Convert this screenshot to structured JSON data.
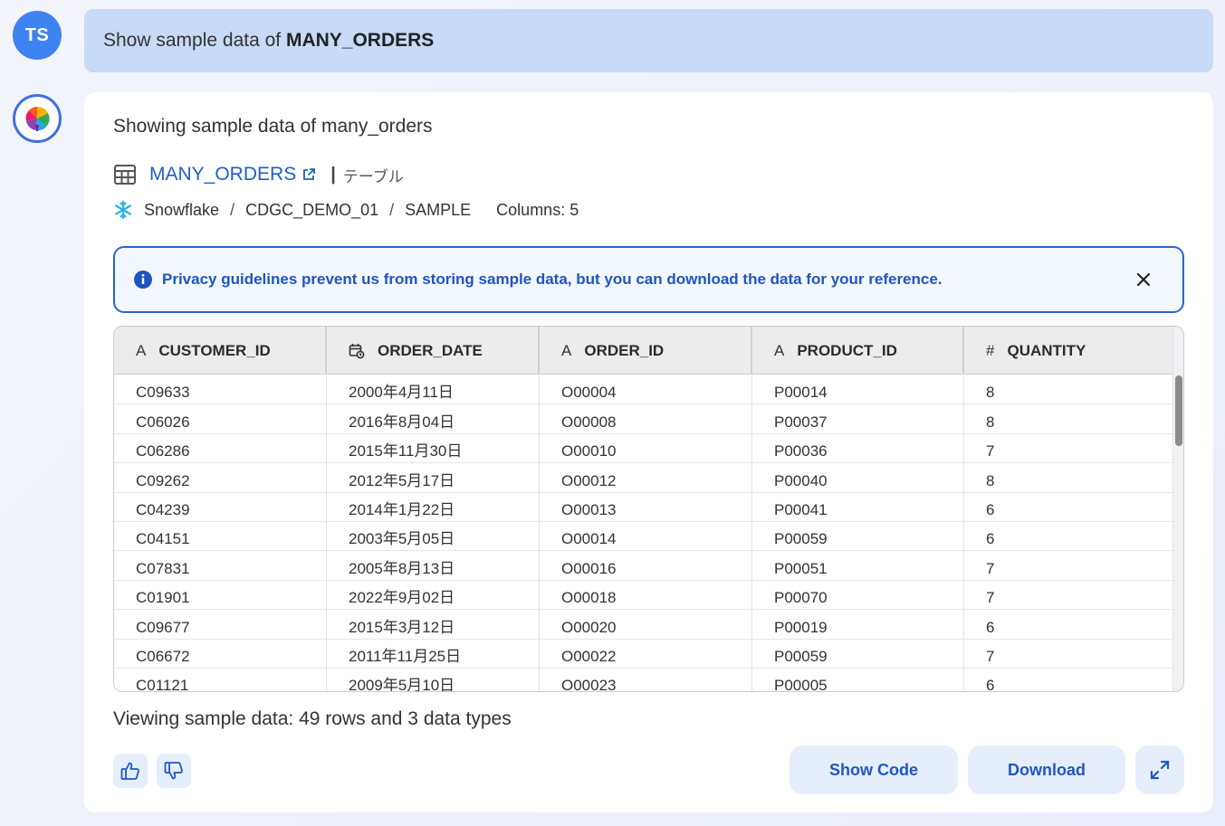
{
  "user": {
    "initials": "TS",
    "message_prefix": "Show sample data of ",
    "message_bold": "MANY_ORDERS"
  },
  "response": {
    "intro": "Showing sample data of many_orders",
    "asset_name": "MANY_ORDERS",
    "asset_separator": "|",
    "asset_type": "テーブル",
    "path": {
      "system": "Snowflake",
      "database": "CDGC_DEMO_01",
      "schema": "SAMPLE",
      "separator": "/",
      "columns_label": "Columns: 5"
    },
    "banner": "Privacy guidelines prevent us from storing sample data, but you can download the data for your reference.",
    "summary": "Viewing sample data: 49 rows and 3 data types"
  },
  "table": {
    "columns": [
      {
        "label": "CUSTOMER_ID",
        "type_icon": "text-type-icon",
        "glyph": "A"
      },
      {
        "label": "ORDER_DATE",
        "type_icon": "date-type-icon",
        "glyph": ""
      },
      {
        "label": "ORDER_ID",
        "type_icon": "text-type-icon",
        "glyph": "A"
      },
      {
        "label": "PRODUCT_ID",
        "type_icon": "text-type-icon",
        "glyph": "A"
      },
      {
        "label": "QUANTITY",
        "type_icon": "number-type-icon",
        "glyph": "#"
      }
    ],
    "rows": [
      [
        "C09633",
        "2000年4月11日",
        "O00004",
        "P00014",
        "8"
      ],
      [
        "C06026",
        "2016年8月04日",
        "O00008",
        "P00037",
        "8"
      ],
      [
        "C06286",
        "2015年11月30日",
        "O00010",
        "P00036",
        "7"
      ],
      [
        "C09262",
        "2012年5月17日",
        "O00012",
        "P00040",
        "8"
      ],
      [
        "C04239",
        "2014年1月22日",
        "O00013",
        "P00041",
        "6"
      ],
      [
        "C04151",
        "2003年5月05日",
        "O00014",
        "P00059",
        "6"
      ],
      [
        "C07831",
        "2005年8月13日",
        "O00016",
        "P00051",
        "7"
      ],
      [
        "C01901",
        "2022年9月02日",
        "O00018",
        "P00070",
        "7"
      ],
      [
        "C09677",
        "2015年3月12日",
        "O00020",
        "P00019",
        "6"
      ],
      [
        "C06672",
        "2011年11月25日",
        "O00022",
        "P00059",
        "7"
      ],
      [
        "C01121",
        "2009年5月10日",
        "O00023",
        "P00005",
        "6"
      ]
    ]
  },
  "actions": {
    "show_code": "Show Code",
    "download": "Download"
  },
  "colors": {
    "accent": "#1f5fc8",
    "user_bubble": "#c7daf7",
    "avatar": "#3f82f1",
    "button_bg": "#e6eefb"
  }
}
